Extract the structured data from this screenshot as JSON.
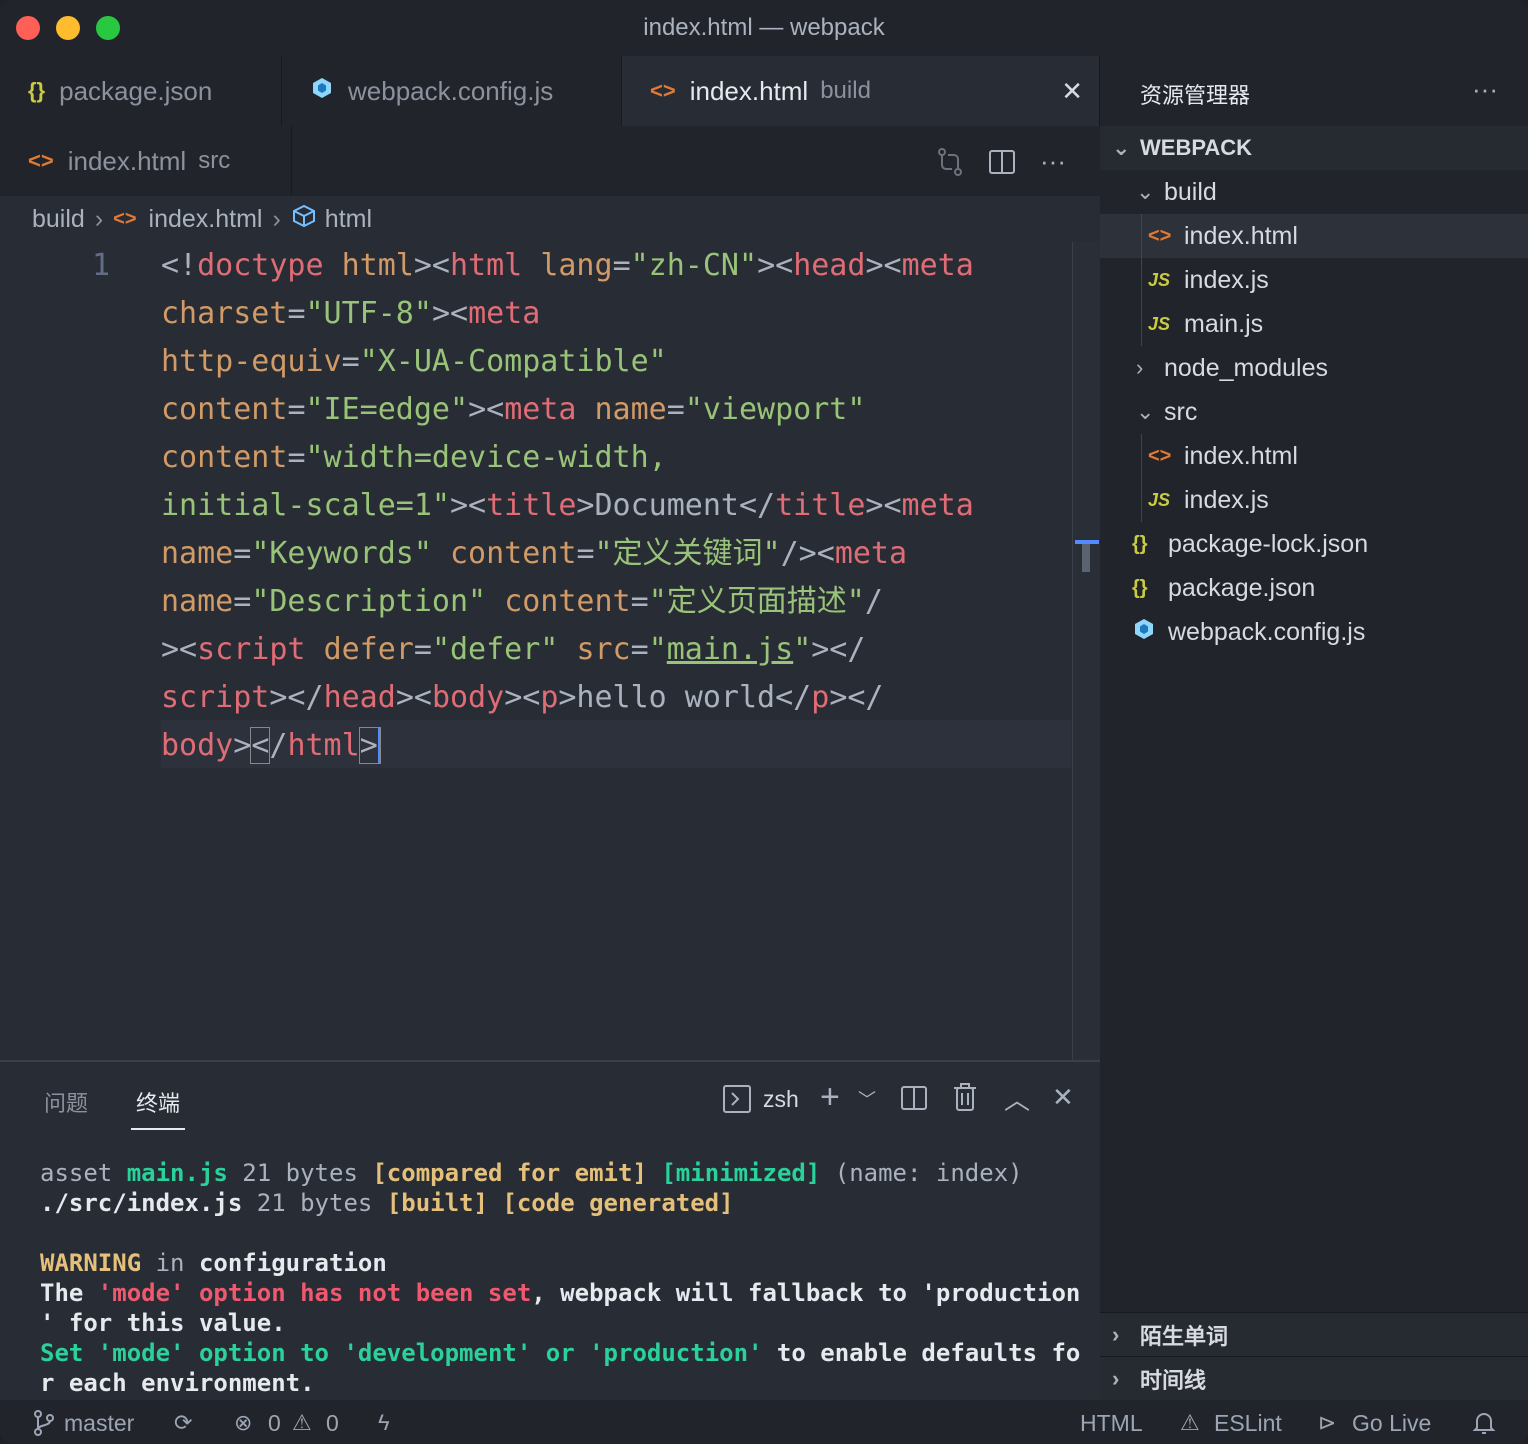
{
  "window": {
    "title": "index.html — webpack"
  },
  "tabs": [
    {
      "icon": "{}",
      "label": "package.json",
      "desc": ""
    },
    {
      "icon": "cube",
      "label": "webpack.config.js",
      "desc": ""
    },
    {
      "icon": "<>",
      "label": "index.html",
      "desc": "build",
      "close": "✕"
    }
  ],
  "tabs2": [
    {
      "icon": "<>",
      "label": "index.html",
      "desc": "src"
    }
  ],
  "breadcrumb": {
    "folder": "build",
    "file": "index.html",
    "symbol": "html"
  },
  "editor": {
    "line_number": "1"
  },
  "panel": {
    "tab_problems": "问题",
    "tab_terminal": "终端",
    "shell": "zsh"
  },
  "terminal": {
    "l1_a": "asset ",
    "l1_b": "main.js",
    "l1_c": " 21 bytes ",
    "l1_d": "[compared for emit]",
    "l1_e": " ",
    "l1_f": "[minimized]",
    "l1_g": " (name: index)",
    "l2_a": "./src/index.js",
    "l2_b": " 21 bytes ",
    "l2_c": "[built] [code generated]",
    "l4_a": "WARNING",
    "l4_b": " in ",
    "l4_c": "configuration",
    "l5_a": "The ",
    "l5_b": "'mode'",
    "l5_c": " option has not been set",
    "l5_d": ", webpack will fallback to 'production",
    "l6": "' for this value.",
    "l7_a": "Set ",
    "l7_b": "'mode'",
    "l7_c": " option to ",
    "l7_d": "'development'",
    "l7_e": " or ",
    "l7_f": "'production'",
    "l7_g": " to enable defaults fo",
    "l8": "r each environment."
  },
  "sidebar": {
    "title": "资源管理器",
    "more": "···",
    "root": "WEBPACK",
    "items": [
      {
        "label": "build",
        "type": "folder-open"
      },
      {
        "label": "index.html",
        "type": "html"
      },
      {
        "label": "index.js",
        "type": "js"
      },
      {
        "label": "main.js",
        "type": "js"
      },
      {
        "label": "node_modules",
        "type": "folder-closed"
      },
      {
        "label": "src",
        "type": "folder-open"
      },
      {
        "label": "index.html",
        "type": "html"
      },
      {
        "label": "index.js",
        "type": "js"
      },
      {
        "label": "package-lock.json",
        "type": "json"
      },
      {
        "label": "package.json",
        "type": "json"
      },
      {
        "label": "webpack.config.js",
        "type": "webpack"
      }
    ],
    "sections": [
      {
        "label": "陌生单词"
      },
      {
        "label": "时间线"
      }
    ]
  },
  "status": {
    "branch": "master",
    "errors": "0",
    "warnings": "0",
    "language": "HTML",
    "eslint": "ESLint",
    "golive": "Go Live"
  },
  "colors": {
    "tag": "#e06c75",
    "attr": "#d19a66",
    "string": "#98c379",
    "accent": "#528bff"
  }
}
